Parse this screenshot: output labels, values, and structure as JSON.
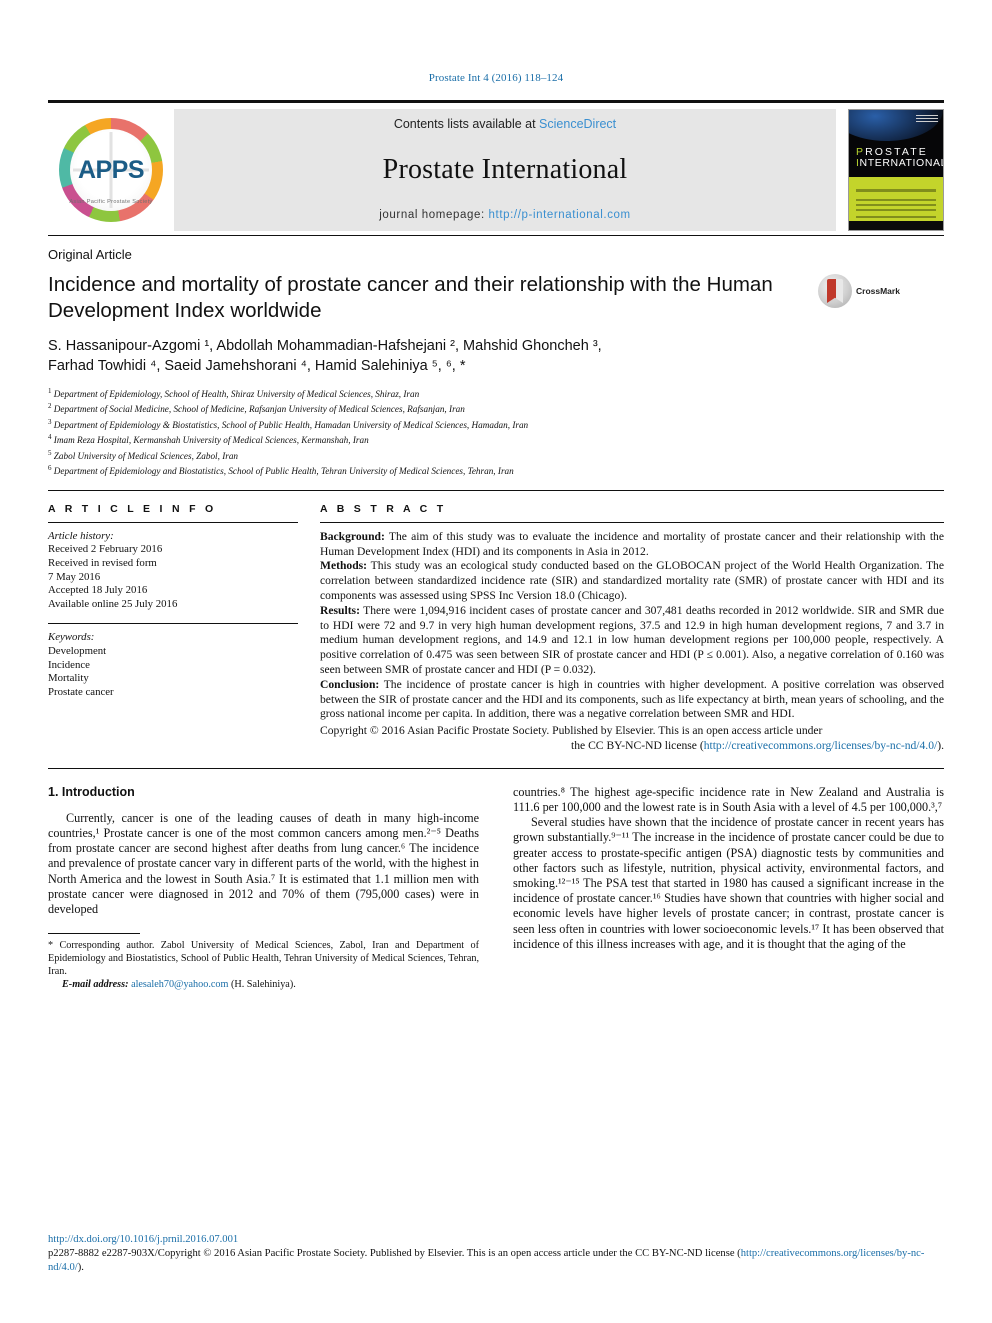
{
  "running_head": "Prostate Int 4 (2016) 118–124",
  "masthead": {
    "contents_prefix": "Contents lists available at ",
    "sciencedirect": "ScienceDirect",
    "journal_title": "Prostate International",
    "homepage_prefix": "journal homepage: ",
    "homepage_url": "http://p-international.com",
    "logo_text": "APPS",
    "logo_subtitle": "Asian Pacific Prostate Society",
    "cover_line1": "PROSTATE",
    "cover_line1_first": "P",
    "cover_line2": "INTERNATIONAL",
    "cover_line2_first": "I"
  },
  "article": {
    "kind": "Original Article",
    "title": "Incidence and mortality of prostate cancer and their relationship with the Human Development Index worldwide",
    "crossmark_label": "CrossMark",
    "authors_line1": "S. Hassanipour-Azgomi ¹, Abdollah Mohammadian-Hafshejani ², Mahshid Ghoncheh ³,",
    "authors_line2": "Farhad Towhidi ⁴, Saeid Jamehshorani ⁴, Hamid Salehiniya ⁵, ⁶, *",
    "affiliations": [
      "Department of Epidemiology, School of Health, Shiraz University of Medical Sciences, Shiraz, Iran",
      "Department of Social Medicine, School of Medicine, Rafsanjan University of Medical Sciences, Rafsanjan, Iran",
      "Department of Epidemiology & Biostatistics, School of Public Health, Hamadan University of Medical Sciences, Hamadan, Iran",
      "Imam Reza Hospital, Kermanshah University of Medical Sciences, Kermanshah, Iran",
      "Zabol University of Medical Sciences, Zabol, Iran",
      "Department of Epidemiology and Biostatistics, School of Public Health, Tehran University of Medical Sciences, Tehran, Iran"
    ]
  },
  "article_info": {
    "heading": "A R T I C L E   I N F O",
    "history_label": "Article history:",
    "history": [
      "Received 2 February 2016",
      "Received in revised form",
      "7 May 2016",
      "Accepted 18 July 2016",
      "Available online 25 July 2016"
    ],
    "keywords_label": "Keywords:",
    "keywords": [
      "Development",
      "Incidence",
      "Mortality",
      "Prostate cancer"
    ]
  },
  "abstract": {
    "heading": "A B S T R A C T",
    "background_label": "Background:",
    "background": " The aim of this study was to evaluate the incidence and mortality of prostate cancer and their relationship with the Human Development Index (HDI) and its components in Asia in 2012.",
    "methods_label": "Methods:",
    "methods": " This study was an ecological study conducted based on the GLOBOCAN project of the World Health Organization. The correlation between standardized incidence rate (SIR) and standardized mortality rate (SMR) of prostate cancer with HDI and its components was assessed using SPSS Inc Version 18.0 (Chicago).",
    "results_label": "Results:",
    "results": " There were 1,094,916 incident cases of prostate cancer and 307,481 deaths recorded in 2012 worldwide. SIR and SMR due to HDI were 72 and 9.7 in very high human development regions, 37.5 and 12.9 in high human development regions, 7 and 3.7 in medium human development regions, and 14.9 and 12.1 in low human development regions per 100,000 people, respectively. A positive correlation of 0.475 was seen between SIR of prostate cancer and HDI (P ≤ 0.001). Also, a negative correlation of 0.160 was seen between SMR of prostate cancer and HDI (P = 0.032).",
    "conclusion_label": "Conclusion:",
    "conclusion": " The incidence of prostate cancer is high in countries with higher development. A positive correlation was observed between the SIR of prostate cancer and the HDI and its components, such as life expectancy at birth, mean years of schooling, and the gross national income per capita. In addition, there was a negative correlation between SMR and HDI.",
    "copyright": "Copyright © 2016 Asian Pacific Prostate Society. Published by Elsevier. This is an open access article under",
    "copyright_line2_prefix": "the CC BY-NC-ND license (",
    "copyright_license_url": "http://creativecommons.org/licenses/by-nc-nd/4.0/",
    "copyright_line2_suffix": ")."
  },
  "body": {
    "section_heading": "1. Introduction",
    "left_paragraph": "Currently, cancer is one of the leading causes of death in many high-income countries,¹ Prostate cancer is one of the most common cancers among men.²⁻⁵ Deaths from prostate cancer are second highest after deaths from lung cancer.⁶ The incidence and prevalence of prostate cancer vary in different parts of the world, with the highest in North America and the lowest in South Asia.⁷ It is estimated that 1.1 million men with prostate cancer were diagnosed in 2012 and 70% of them (795,000 cases) were in developed",
    "right_paragraph_1": "countries.⁸ The highest age-specific incidence rate in New Zealand and Australia is 111.6 per 100,000 and the lowest rate is in South Asia with a level of 4.5 per 100,000.³,⁷",
    "right_paragraph_2": "Several studies have shown that the incidence of prostate cancer in recent years has grown substantially.⁹⁻¹¹ The increase in the incidence of prostate cancer could be due to greater access to prostate-specific antigen (PSA) diagnostic tests by communities and other factors such as lifestyle, nutrition, physical activity, environmental factors, and smoking.¹²⁻¹⁵ The PSA test that started in 1980 has caused a significant increase in the incidence of prostate cancer.¹⁶ Studies have shown that countries with higher social and economic levels have higher levels of prostate cancer; in contrast, prostate cancer is seen less often in countries with lower socioeconomic levels.¹⁷ It has been observed that incidence of this illness increases with age, and it is thought that the aging of the"
  },
  "footnotes": {
    "corresponding": "* Corresponding author. Zabol University of Medical Sciences, Zabol, Iran and Department of Epidemiology and Biostatistics, School of Public Health, Tehran University of Medical Sciences, Tehran, Iran.",
    "email_label": "E-mail address:",
    "email": "alesaleh70@yahoo.com",
    "email_owner": " (H. Salehiniya).",
    "doi": "http://dx.doi.org/10.1016/j.prnil.2016.07.001",
    "issn_line": "p2287-8882 e2287-903X/Copyright © 2016 Asian Pacific Prostate Society. Published by Elsevier. This is an open access article under the CC BY-NC-ND license (",
    "issn_license_url": "http://creativecommons.org/licenses/by-nc-nd/4.0/",
    "issn_suffix": ")."
  },
  "colors": {
    "link": "#1a6ea8",
    "band_bg": "#e6e6e6",
    "cover_accent": "#c3d42b"
  }
}
